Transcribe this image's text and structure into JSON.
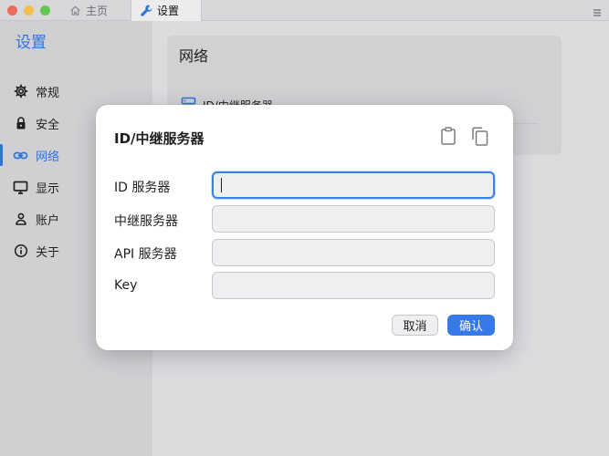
{
  "window": {
    "tabs": [
      {
        "label": "主页",
        "icon": "home-icon"
      },
      {
        "label": "设置",
        "icon": "wrench-icon"
      }
    ]
  },
  "sidebar": {
    "title": "设置",
    "items": [
      {
        "label": "常规",
        "icon": "gear-icon"
      },
      {
        "label": "安全",
        "icon": "lock-icon"
      },
      {
        "label": "网络",
        "icon": "link-icon",
        "active": true
      },
      {
        "label": "显示",
        "icon": "monitor-icon"
      },
      {
        "label": "账户",
        "icon": "user-icon"
      },
      {
        "label": "关于",
        "icon": "info-icon"
      }
    ]
  },
  "main": {
    "section_title": "网络",
    "row_label": "ID/中继服务器"
  },
  "dialog": {
    "title": "ID/中继服务器",
    "fields": [
      {
        "label": "ID 服务器",
        "value": "",
        "placeholder": ""
      },
      {
        "label": "中继服务器",
        "value": "",
        "placeholder": ""
      },
      {
        "label": "API 服务器",
        "value": "",
        "placeholder": ""
      },
      {
        "label": "Key",
        "value": "",
        "placeholder": ""
      }
    ],
    "cancel_label": "取消",
    "ok_label": "确认"
  },
  "colors": {
    "accent": "#2f74d8",
    "primary_button": "#3679e8",
    "sidebar_bg": "#d0d0d3",
    "dialog_bg": "#ffffff"
  }
}
